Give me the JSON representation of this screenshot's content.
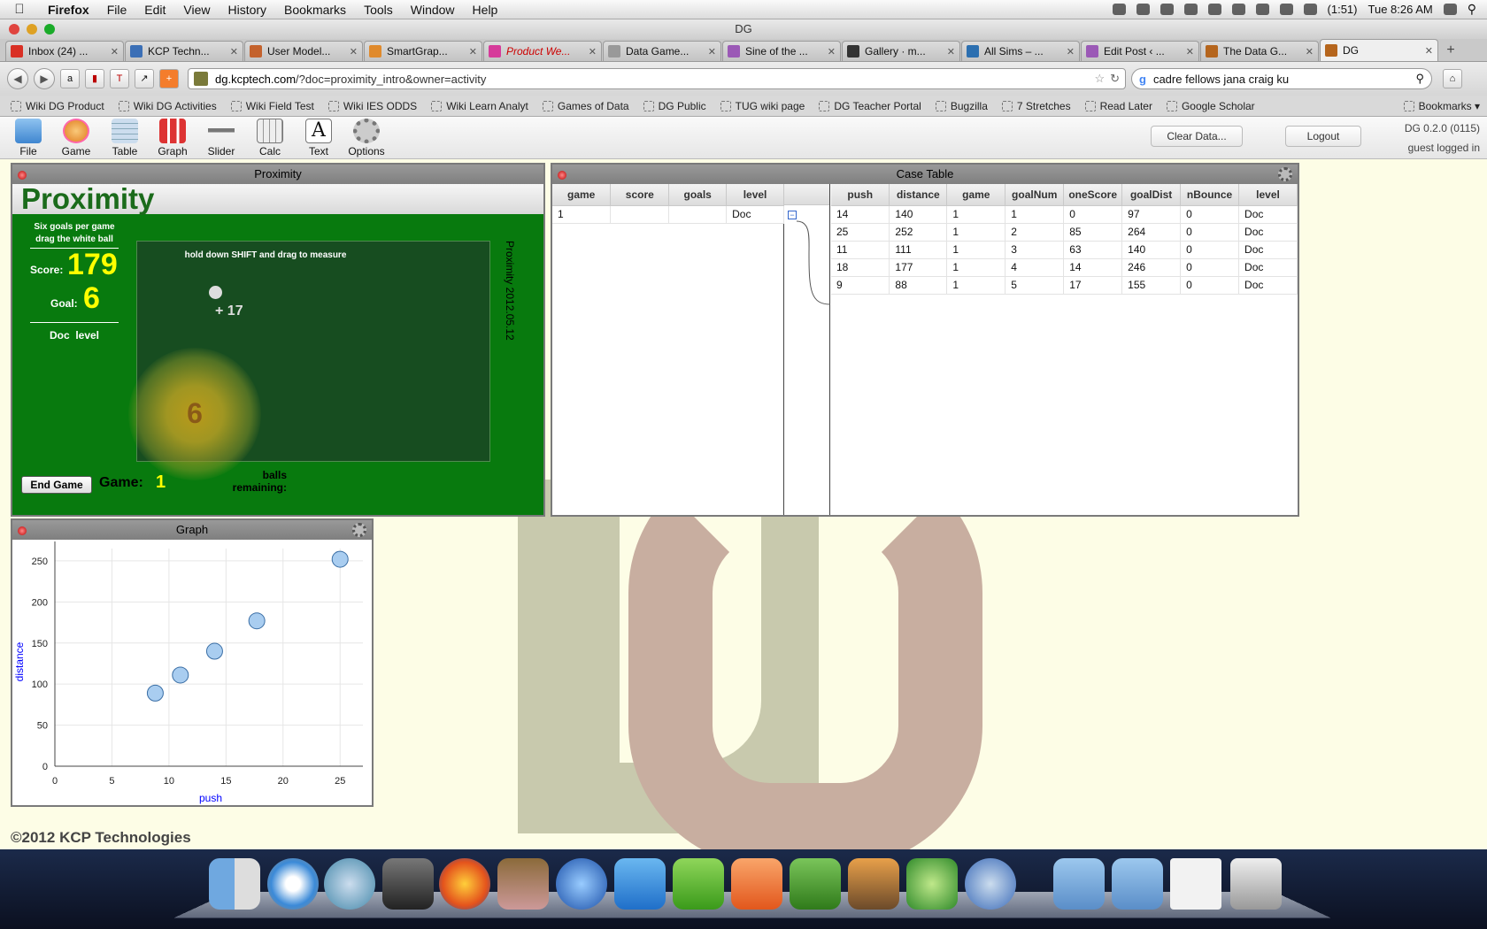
{
  "menubar": {
    "apple": "",
    "app": "Firefox",
    "items": [
      "File",
      "Edit",
      "View",
      "History",
      "Bookmarks",
      "Tools",
      "Window",
      "Help"
    ],
    "battery": "(1:51)",
    "clock": "Tue 8:26 AM"
  },
  "window": {
    "title": "DG"
  },
  "tabs": [
    {
      "label": "Inbox (24) ...",
      "color": "#d93025"
    },
    {
      "label": "KCP Techn...",
      "color": "#3b6fb6"
    },
    {
      "label": "User Model...",
      "color": "#c4622d"
    },
    {
      "label": "SmartGrap...",
      "color": "#e08a2c"
    },
    {
      "label": "Product We...",
      "color": "#d63a9a"
    },
    {
      "label": "Data Game...",
      "color": "#999999"
    },
    {
      "label": "Sine of the ...",
      "color": "#9b59b6"
    },
    {
      "label": "Gallery · m...",
      "color": "#333333"
    },
    {
      "label": "All Sims – ...",
      "color": "#2c6fb0"
    },
    {
      "label": "Edit Post ‹ ...",
      "color": "#9b59b6"
    },
    {
      "label": "The Data G...",
      "color": "#b5651d"
    },
    {
      "label": "DG",
      "color": "#b5651d"
    }
  ],
  "nav": {
    "url_domain": "dg.kcptech.com",
    "url_rest": "/?doc=proximity_intro&owner=activity",
    "search_value": "cadre fellows jana craig ku"
  },
  "bookmarks": [
    "Wiki DG Product",
    "Wiki DG Activities",
    "Wiki Field Test",
    "Wiki IES ODDS",
    "Wiki Learn Analyt",
    "Games of Data",
    "DG Public",
    "TUG wiki page",
    "DG Teacher Portal",
    "Bugzilla",
    "7 Stretches",
    "Read Later",
    "Google Scholar"
  ],
  "bookmarks_menu": "Bookmarks",
  "toolbar": {
    "tools": [
      "File",
      "Game",
      "Table",
      "Graph",
      "Slider",
      "Calc",
      "Text",
      "Options"
    ],
    "clear": "Clear Data...",
    "logout": "Logout",
    "version": "DG 0.2.0 (0115)",
    "user": "guest logged in"
  },
  "proximity": {
    "panel_title": "Proximity",
    "game_title": "Proximity",
    "instructions_1": "Six goals per game",
    "instructions_2": "drag the white ball",
    "score_label": "Score:",
    "score": "179",
    "goal_label": "Goal:",
    "goal": "6",
    "level_label": "Doc  level",
    "hint": "hold down SHIFT and drag to measure",
    "ball_label": "+ 17",
    "target_number": "6",
    "version_text": "Proximity 2012.05.12",
    "end_button": "End Game",
    "game_label": "Game:",
    "game_number": "1",
    "balls_remaining": "balls remaining:"
  },
  "case_table": {
    "title": "Case Table",
    "parent_headers": [
      "game",
      "score",
      "goals",
      "level"
    ],
    "parent_rows": [
      [
        "1",
        "",
        "",
        "Doc"
      ]
    ],
    "child_headers": [
      "push",
      "distance",
      "game",
      "goalNum",
      "oneScore",
      "goalDist",
      "nBounce",
      "level"
    ],
    "child_rows": [
      [
        "14",
        "140",
        "1",
        "1",
        "0",
        "97",
        "0",
        "Doc"
      ],
      [
        "25",
        "252",
        "1",
        "2",
        "85",
        "264",
        "0",
        "Doc"
      ],
      [
        "11",
        "111",
        "1",
        "3",
        "63",
        "140",
        "0",
        "Doc"
      ],
      [
        "18",
        "177",
        "1",
        "4",
        "14",
        "246",
        "0",
        "Doc"
      ],
      [
        "9",
        "88",
        "1",
        "5",
        "17",
        "155",
        "0",
        "Doc"
      ]
    ],
    "collapse_glyph": "−"
  },
  "graph": {
    "title": "Graph",
    "chart_data": {
      "type": "scatter",
      "xlabel": "push",
      "ylabel": "distance",
      "xlim": [
        0,
        27
      ],
      "ylim": [
        0,
        265
      ],
      "xticks": [
        0,
        5,
        10,
        15,
        20,
        25
      ],
      "yticks": [
        0,
        50,
        100,
        150,
        200,
        250
      ],
      "points": [
        {
          "x": 14,
          "y": 140
        },
        {
          "x": 25,
          "y": 252
        },
        {
          "x": 11,
          "y": 111
        },
        {
          "x": 17.7,
          "y": 177
        },
        {
          "x": 8.8,
          "y": 89
        }
      ],
      "point_color": "#a9cdf0",
      "grid": true
    }
  },
  "footer": {
    "copyright": "©2012 KCP Technologies"
  }
}
